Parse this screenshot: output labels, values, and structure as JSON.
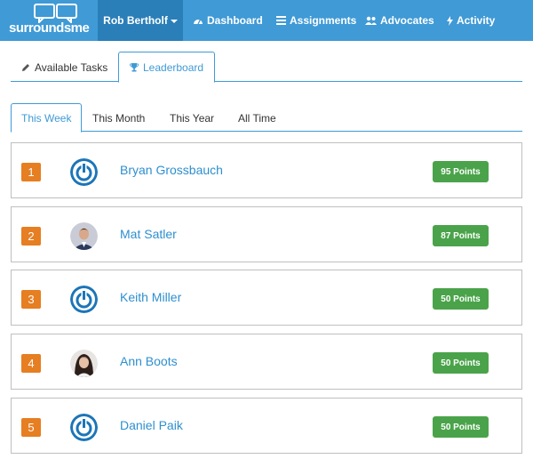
{
  "brand": {
    "logo_text": "surroundsme"
  },
  "nav": {
    "user": "Rob Bertholf",
    "items": [
      {
        "label": "Dashboard",
        "icon": "dashboard-icon"
      },
      {
        "label": "Assignments",
        "icon": "list-icon"
      },
      {
        "label": "Advocates",
        "icon": "users-icon"
      },
      {
        "label": "Activity",
        "icon": "bolt-icon"
      }
    ]
  },
  "primary_tabs": [
    {
      "label": "Available Tasks",
      "icon": "pencil-icon",
      "active": false
    },
    {
      "label": "Leaderboard",
      "icon": "trophy-icon",
      "active": true
    }
  ],
  "period_tabs": [
    {
      "label": "This Week",
      "active": true
    },
    {
      "label": "This Month",
      "active": false
    },
    {
      "label": "This Year",
      "active": false
    },
    {
      "label": "All Time",
      "active": false
    }
  ],
  "leaderboard": [
    {
      "rank": "1",
      "name": "Bryan Grossbauch",
      "points": "95 Points",
      "avatar": "power-icon"
    },
    {
      "rank": "2",
      "name": "Mat Satler",
      "points": "87 Points",
      "avatar": "photo-man"
    },
    {
      "rank": "3",
      "name": "Keith Miller",
      "points": "50 Points",
      "avatar": "power-icon"
    },
    {
      "rank": "4",
      "name": "Ann Boots",
      "points": "50 Points",
      "avatar": "photo-woman"
    },
    {
      "rank": "5",
      "name": "Daniel Paik",
      "points": "50 Points",
      "avatar": "power-icon"
    }
  ],
  "colors": {
    "navbar": "#3f9ad6",
    "navbar_active": "#2a7fb8",
    "rank_badge": "#e67e22",
    "points_badge": "#4aa34a",
    "link": "#2e8fcf"
  }
}
